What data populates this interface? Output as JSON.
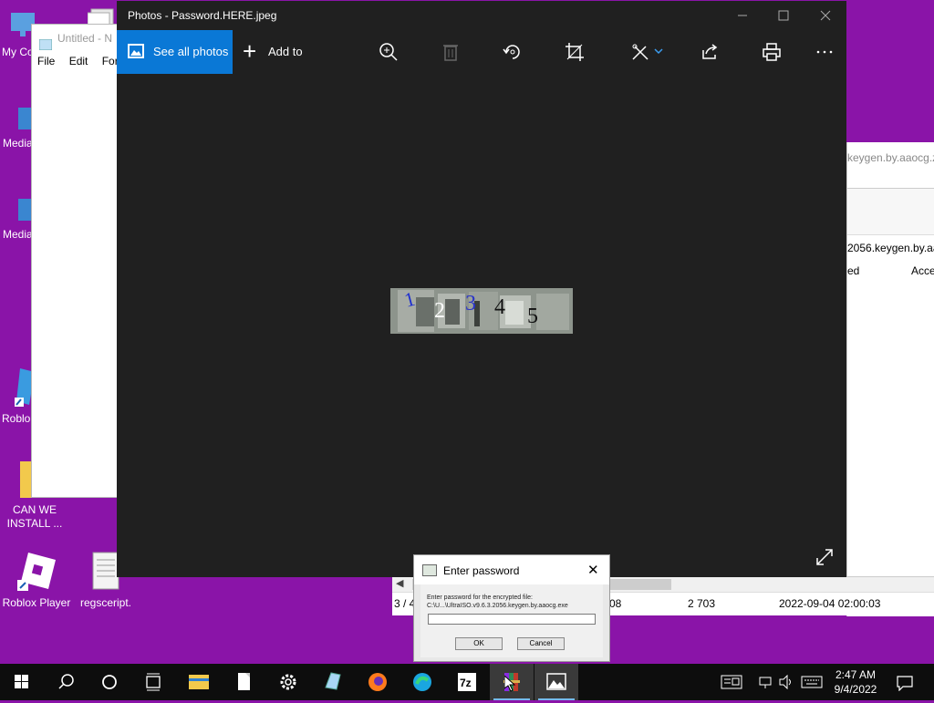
{
  "desktop": {
    "icons": {
      "my_computer": "My Co",
      "media1": "Media",
      "media2": "Media",
      "roblox1": "Roblo",
      "can_we_install": "CAN WE\nINSTALL ...",
      "roblox_player": "Roblox Player",
      "regscript": "regsceript."
    },
    "background_color": "#8a14a8"
  },
  "notepad": {
    "title": "Untitled - N",
    "menu": [
      "File",
      "Edit",
      "Forr"
    ]
  },
  "archive": {
    "path_text": "keygen.by.aaocg.z",
    "file_text": "2056.keygen.by.aa",
    "col_modified": "ed",
    "col_accessed": "Acce",
    "status": {
      "page": "3 / 4",
      "size_fragment": "08",
      "packed": "2 703",
      "date": "2022-09-04 02:00:03"
    }
  },
  "photos": {
    "window_title": "Photos - Password.HERE.jpeg",
    "see_all_label": "See all photos",
    "add_to_label": "Add to",
    "toolbar_icons": [
      "zoom-icon",
      "delete-icon",
      "rotate-icon",
      "crop-icon",
      "edit-icon",
      "share-icon",
      "print-icon",
      "more-icon"
    ],
    "captcha_digits": [
      "1",
      "2",
      "3",
      "4",
      "5"
    ],
    "accent": "#0a78d6"
  },
  "dialog": {
    "title": "Enter password",
    "prompt": "Enter password for the encrypted file:",
    "file": "C:\\U...\\UltraISO.v9.6.3.2056.keygen.by.aaocg.exe",
    "password_value": "",
    "ok_label": "OK",
    "cancel_label": "Cancel"
  },
  "taskbar": {
    "time": "2:47 AM",
    "date": "9/4/2022",
    "apps": [
      "start",
      "search",
      "cortana",
      "task-view",
      "file-explorer",
      "notepad",
      "settings",
      "notepad-alt",
      "firefox",
      "edge",
      "7zip",
      "winrar",
      "photos"
    ]
  }
}
